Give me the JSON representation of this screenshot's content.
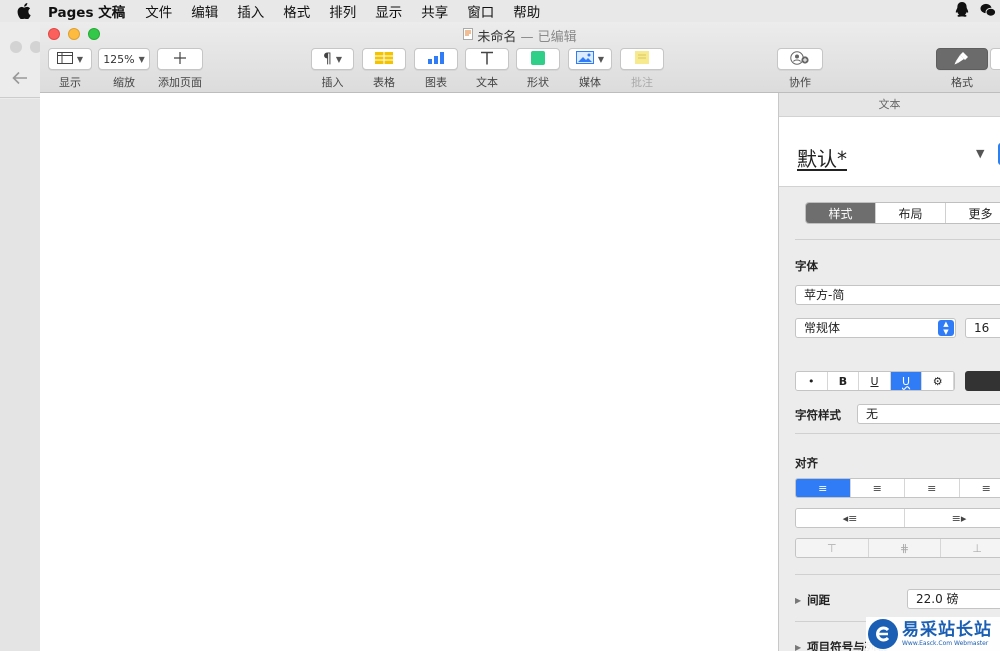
{
  "menubar": {
    "app_name": "Pages 文稿",
    "items": [
      "文件",
      "编辑",
      "插入",
      "格式",
      "排列",
      "显示",
      "共享",
      "窗口",
      "帮助"
    ]
  },
  "window": {
    "title": "未命名",
    "title_suffix": "— 已编辑"
  },
  "toolbar": {
    "view_label": "显示",
    "zoom_value": "125%",
    "zoom_label": "缩放",
    "add_page_label": "添加页面",
    "insert_label": "插入",
    "table_label": "表格",
    "chart_label": "图表",
    "text_label": "文本",
    "shape_label": "形状",
    "media_label": "媒体",
    "comment_label": "批注",
    "collaborate_label": "协作",
    "format_label": "格式"
  },
  "inspector": {
    "header": "文本",
    "paragraph_style": "默认*",
    "tabs": [
      "样式",
      "布局",
      "更多"
    ],
    "font_section": "字体",
    "font_family": "苹方-简",
    "font_typeface": "常规体",
    "font_size": "16",
    "format_buttons": [
      "•",
      "B",
      "U",
      "U",
      "⚙"
    ],
    "char_style_label": "字符样式",
    "char_style_value": "无",
    "align_section": "对齐",
    "spacing_label": "间距",
    "spacing_value": "22.0 磅",
    "bullets_label": "项目符号与列表"
  },
  "watermark": {
    "title": "易采站长站",
    "subtitle": "Www.Easck.Com Webmaster"
  },
  "colors": {
    "accent": "#2f7cf6",
    "close": "#fc605c",
    "minimize": "#fdbc40",
    "zoom": "#34c84a"
  }
}
